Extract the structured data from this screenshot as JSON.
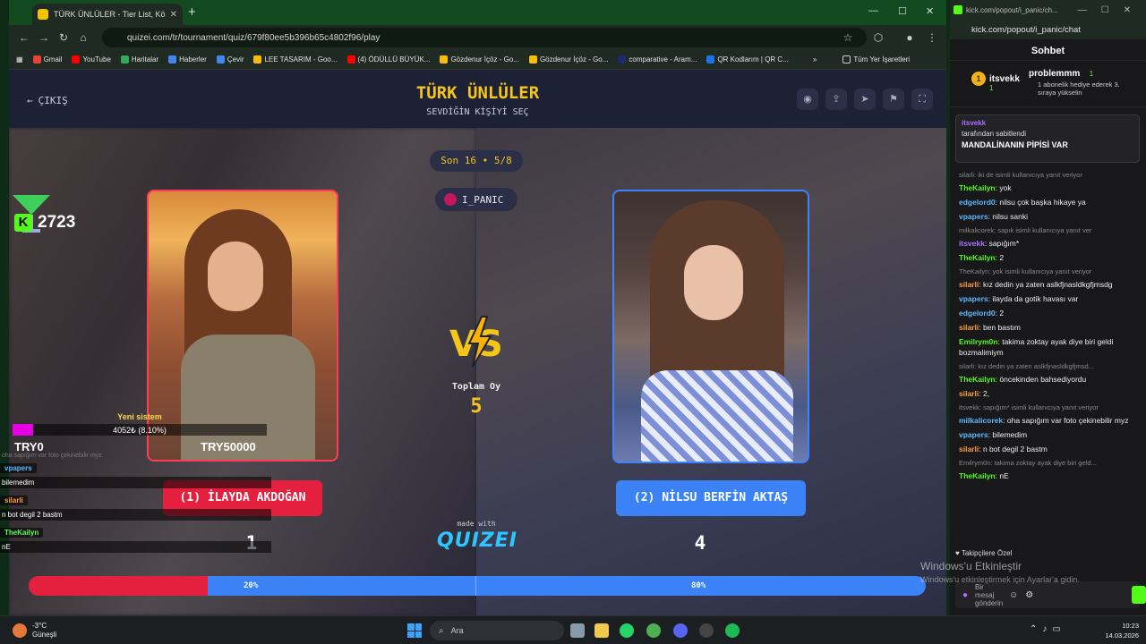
{
  "browser": {
    "tab_title": "TÜRK ÜNLÜLER - Tier List, Kör",
    "new_tab": "+",
    "url": "quizei.com/tr/tournament/quiz/679f80ee5b396b65c4802f96/play",
    "bookmarks": [
      "Gmail",
      "YouTube",
      "Haritalar",
      "Haberler",
      "Çevir",
      "LEE TASARIM - Goo...",
      "(4) ÖDÜLLÜ BÜYÜK...",
      "Gözdenur İçöz - Go...",
      "Gözdenur İçöz - Go...",
      "comparative - Aram...",
      "QR Kodlarım | QR C..."
    ],
    "bookmarks_more": "»",
    "all_bookmarks": "Tüm Yer İşaretleri",
    "bookmark_colors": [
      "#ea4335",
      "#ff0000",
      "#34a853",
      "#4285f4",
      "#4285f4",
      "#fbbc04",
      "#ff0000",
      "#fbbc04",
      "#fbbc04",
      "#1e2a6e",
      "#1a73e8"
    ]
  },
  "quiz": {
    "exit_label": "ÇIKIŞ",
    "title": "TÜRK ÜNLÜLER",
    "subtitle": "SEVDİĞİN KİŞİYİ SEÇ",
    "header_icons": [
      "eye-icon",
      "share-icon",
      "send-icon",
      "flag-icon",
      "fullscreen-icon"
    ],
    "round": "Son 16 • 5/8",
    "streamer": "I_PANIC",
    "vs": "VS",
    "total_label": "Toplam Oy",
    "total_value": "5",
    "made_with": "made with",
    "logo": "QUIZEI",
    "left": {
      "choice": "(1) İLAYDA AKDOĞAN",
      "votes": "1",
      "percent": "20%",
      "share": 0.2
    },
    "right": {
      "choice": "(2) NİLSU BERFİN AKTAŞ",
      "votes": "4",
      "percent": "80%",
      "share": 0.8
    },
    "colors": {
      "accent": "#f5c518",
      "left": "#e5203e",
      "right": "#3b82f6"
    }
  },
  "overlay": {
    "kick_count": "2723",
    "kick_letter": "K",
    "new_system": "Yeni sistem",
    "progress_text": "4052₺ (8.10%)",
    "progress_value": 0.081,
    "try_start": "TRY0",
    "try_goal": "TRY50000",
    "faded": "oha sapığım var foto çekinebilir myz",
    "messages": [
      {
        "user": "vpapers",
        "text": "bilemedim",
        "color": "#5cb8ff"
      },
      {
        "user": "silarli",
        "text": "n bot degil 2 bastm",
        "color": "#ff9b3d"
      },
      {
        "user": "TheKailyn",
        "text": "nE",
        "color": "#5cff5c"
      }
    ]
  },
  "chat": {
    "window_url": "kick.com/popout/i_panic/ch...",
    "url": "kick.com/popout/i_panic/chat",
    "title": "Sohbet",
    "gifter_a": {
      "name": "itsvekk",
      "count": "1",
      "rank": "1"
    },
    "gifter_b": {
      "name": "problemmm",
      "count": "1",
      "desc": "1 abonelik hediye ederek 3. sıraya yükselin"
    },
    "pinned": {
      "user": "itsvekk",
      "by": "tarafından sabitlendi",
      "message": "MANDALİNANIN PİPİSİ VAR"
    },
    "log": [
      {
        "reply": "silarli: iki de isimli kullanıcıya yanıt veriyor"
      },
      {
        "user": "TheKailyn",
        "color": "#53fc18",
        "text": "yok"
      },
      {
        "user": "edgelord0",
        "color": "#5cb8ff",
        "text": "nilsu çok başka hikaye ya"
      },
      {
        "user": "vpapers",
        "color": "#5cb8ff",
        "text": "nilsu sanki"
      },
      {
        "reply": "milkalicorek: sapık isimli kullanıcıya yanıt ver"
      },
      {
        "user": "itsvekk",
        "color": "#a970ff",
        "text": "sapığım*"
      },
      {
        "user": "TheKailyn",
        "color": "#53fc18",
        "text": "2"
      },
      {
        "reply": "TheKailyn: yok isimli kullanıcıya yanıt veriyor"
      },
      {
        "user": "silarli",
        "color": "#ff9b3d",
        "text": "kız dedin ya zaten aslkfjnasldkgfjmsdg"
      },
      {
        "user": "vpapers",
        "color": "#5cb8ff",
        "text": "ilayda da gotik havası var"
      },
      {
        "user": "edgelord0",
        "color": "#5cb8ff",
        "text": "2"
      },
      {
        "user": "silarli",
        "color": "#ff9b3d",
        "text": "ben bastım"
      },
      {
        "user": "Emilrym0n",
        "color": "#53fc18",
        "text": "takima zoktay ayak diye biri geldi bozmalimiym"
      },
      {
        "reply": "silarli: kız dedin ya zaten aslkfjnasldkgfjmsd..."
      },
      {
        "user": "TheKailyn",
        "color": "#53fc18",
        "text": "öncekinden bahsediyordu"
      },
      {
        "user": "silarli",
        "color": "#ff9b3d",
        "text": "2,"
      },
      {
        "reply": "itsvekk: sapığım* isimli kullanıcıya yanıt veriyor"
      },
      {
        "user": "milkalicorek",
        "color": "#5cb8ff",
        "text": "oha sapığım var foto çekinebilir myz"
      },
      {
        "user": "vpapers",
        "color": "#5cb8ff",
        "text": "bilemedim"
      },
      {
        "user": "silarli",
        "color": "#ff9b3d",
        "text": "n bot degil 2 bastm"
      },
      {
        "reply": "Emilrym0n: takima zoktay ayak diye biri geld..."
      },
      {
        "user": "TheKailyn",
        "color": "#53fc18",
        "text": "nE"
      }
    ],
    "followers": "Takipçilere Özel",
    "send_placeholder": "Bir mesaj gönderin"
  },
  "windows_activate": {
    "title": "Windows'u Etkinleştir",
    "sub": "Windows'u etkinleştirmek için Ayarlar'a gidin."
  },
  "taskbar": {
    "temp": "-3°C",
    "weather": "Güneşli",
    "search": "Ara",
    "time": "10:23",
    "date": "14.03.2026"
  }
}
